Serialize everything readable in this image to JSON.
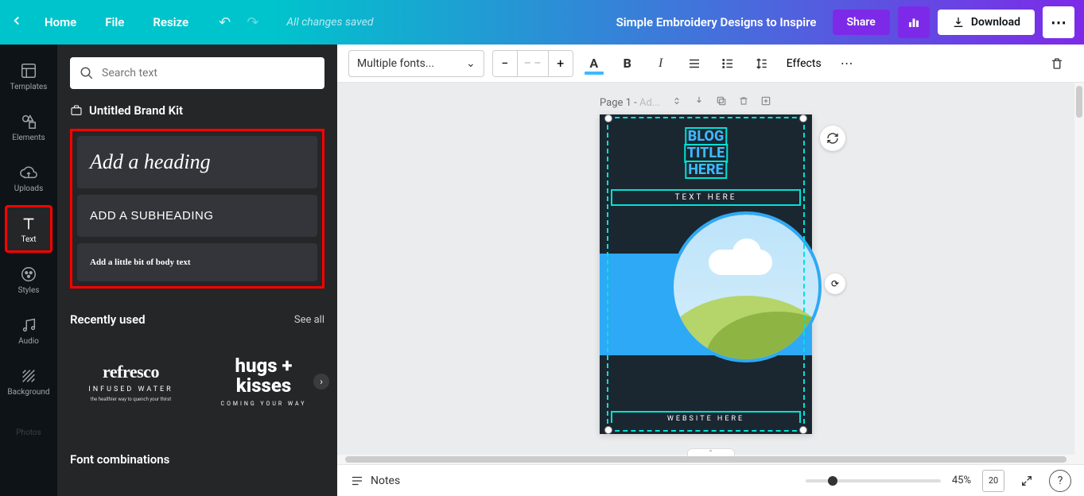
{
  "topbar": {
    "home": "Home",
    "file": "File",
    "resize": "Resize",
    "status": "All changes saved",
    "doc_title": "Simple Embroidery Designs to Inspire",
    "share": "Share",
    "download": "Download"
  },
  "rail": {
    "templates": "Templates",
    "elements": "Elements",
    "uploads": "Uploads",
    "text": "Text",
    "styles": "Styles",
    "audio": "Audio",
    "background": "Background",
    "photos": "Photos"
  },
  "panel": {
    "search_placeholder": "Search text",
    "brand_kit": "Untitled Brand Kit",
    "heading": "Add a heading",
    "subheading": "ADD A SUBHEADING",
    "body": "Add a little bit of body text",
    "recently_used": "Recently used",
    "see_all": "See all",
    "font_combinations": "Font combinations",
    "recent": {
      "refresco": {
        "title": "refresco",
        "sub1": "INFUSED WATER",
        "sub2": "the healthier way to quench your thirst"
      },
      "hugs": {
        "line1": "hugs +",
        "line2": "kisses",
        "sub": "COMING YOUR WAY"
      }
    }
  },
  "toolbar": {
    "font": "Multiple fonts...",
    "size_placeholder": "– –",
    "color_glyph": "A",
    "bold_glyph": "B",
    "italic_glyph": "I",
    "effects": "Effects"
  },
  "page": {
    "label_prefix": "Page 1 - ",
    "label_hint": "Ad...",
    "blog_line1": "BLOG",
    "blog_line2": "TITLE",
    "blog_line3": "HERE",
    "text_here": "TEXT HERE",
    "website_here": "WEBSITE HERE"
  },
  "footer": {
    "notes": "Notes",
    "zoom": "45%",
    "grid_count": "20"
  }
}
